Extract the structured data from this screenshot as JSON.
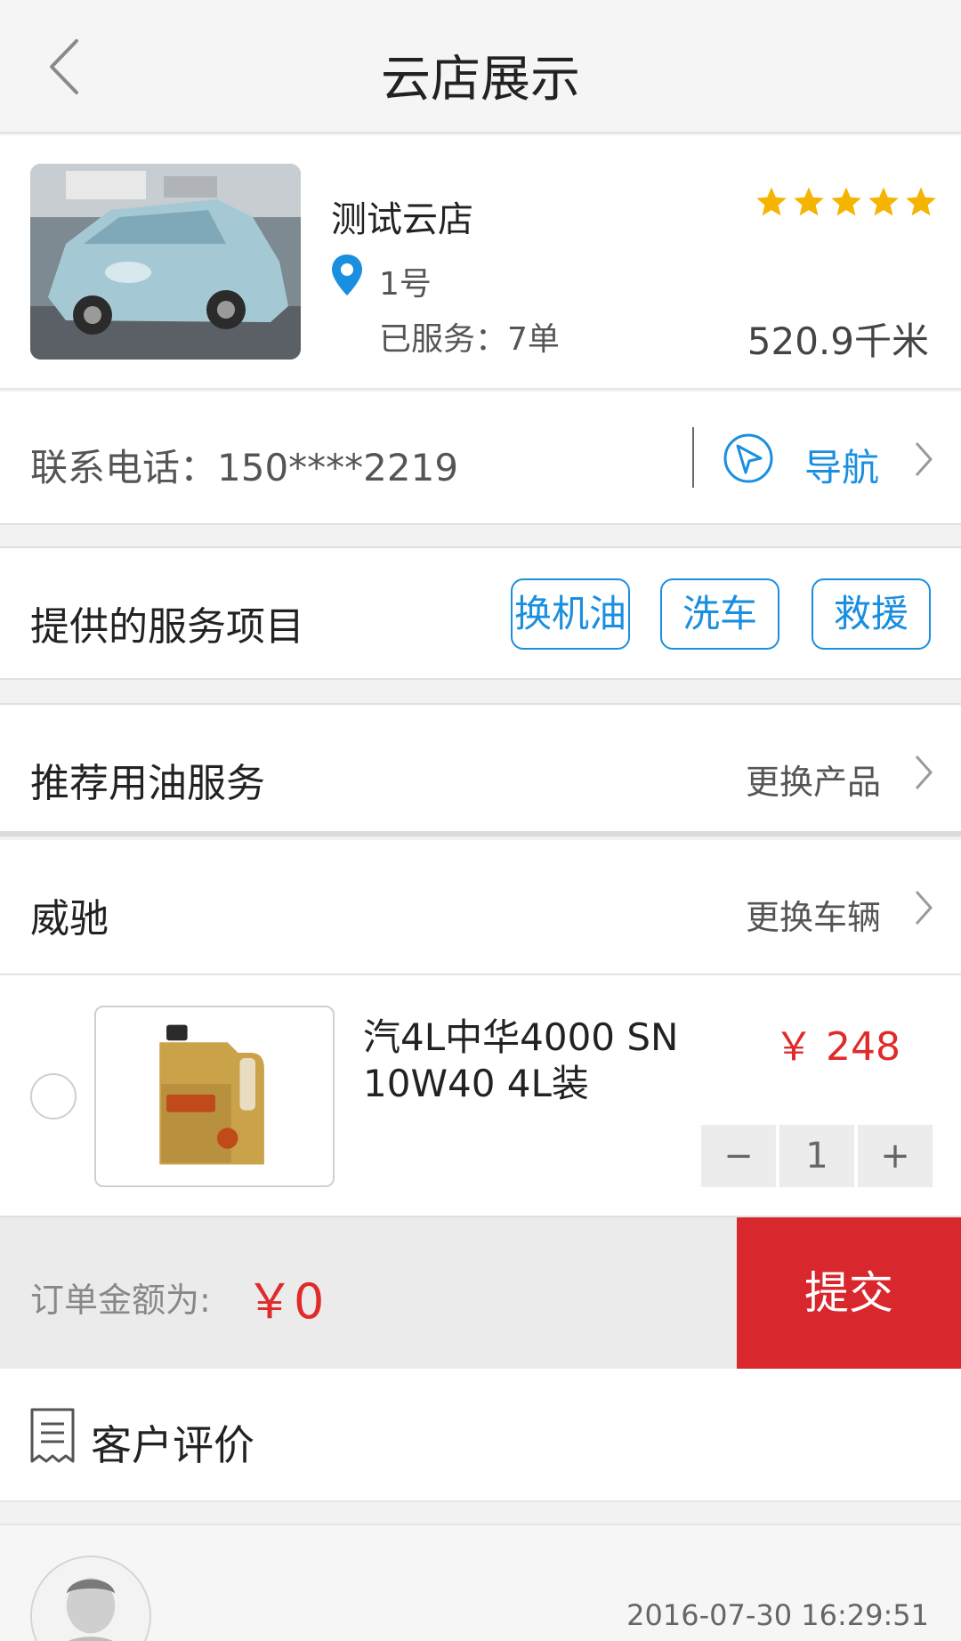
{
  "header": {
    "title": "云店展示"
  },
  "store": {
    "name": "测试云店",
    "rating": 5,
    "address": "1号",
    "served": "已服务：7单",
    "distance": "520.9千米"
  },
  "contact": {
    "phone_text": "联系电话：150****2219",
    "nav_label": "导航"
  },
  "services": {
    "title": "提供的服务项目",
    "tags": [
      "换机油",
      "洗车",
      "救援"
    ]
  },
  "recommend": {
    "title": "推荐用油服务",
    "action": "更换产品"
  },
  "vehicle": {
    "name": "威驰",
    "action": "更换车辆"
  },
  "product": {
    "name": "汽4L中华4000 SN 10W40 4L装",
    "price": "￥ 248",
    "quantity": "1",
    "minus": "−",
    "plus": "+"
  },
  "order": {
    "label": "订单金额为:",
    "total": "￥0",
    "submit": "提交"
  },
  "reviews": {
    "title": "客户评价",
    "items": [
      {
        "time": "2016-07-30 16:29:51"
      }
    ]
  },
  "colors": {
    "accent": "#1a8fe0",
    "price": "#e02b2b",
    "submit_bg": "#d8282e",
    "star": "#f5b400"
  }
}
